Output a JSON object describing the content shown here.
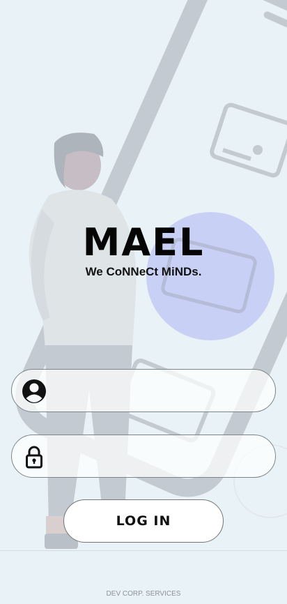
{
  "app": {
    "logo_text": "MAEL",
    "tagline": "We CoNNeCt MiNDs."
  },
  "login_form": {
    "username": {
      "value": "",
      "placeholder": "",
      "icon": "user-circle-icon"
    },
    "password": {
      "value": "",
      "placeholder": "",
      "icon": "lock-icon"
    },
    "login_label": "LOG IN"
  },
  "footer": {
    "text": "DEV CORP. SERVICES"
  },
  "colors": {
    "background": "#e9f2f6",
    "illustration_gray": "#c3cad1",
    "accent_circle": "#c9d0f6",
    "text": "#111111"
  }
}
